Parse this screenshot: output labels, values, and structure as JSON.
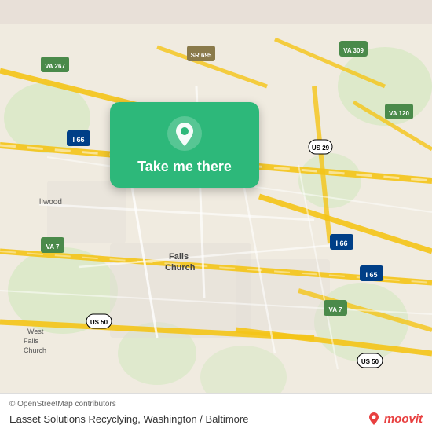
{
  "map": {
    "background_color": "#f2ede4",
    "alt": "Map of Falls Church, Virginia area"
  },
  "card": {
    "label": "Take me there",
    "background_color": "#2db87a",
    "pin_icon": "location-pin-icon"
  },
  "bottom_bar": {
    "copyright": "© OpenStreetMap contributors",
    "location_name": "Easset Solutions Recyclying, Washington / Baltimore",
    "moovit_label": "moovit"
  }
}
